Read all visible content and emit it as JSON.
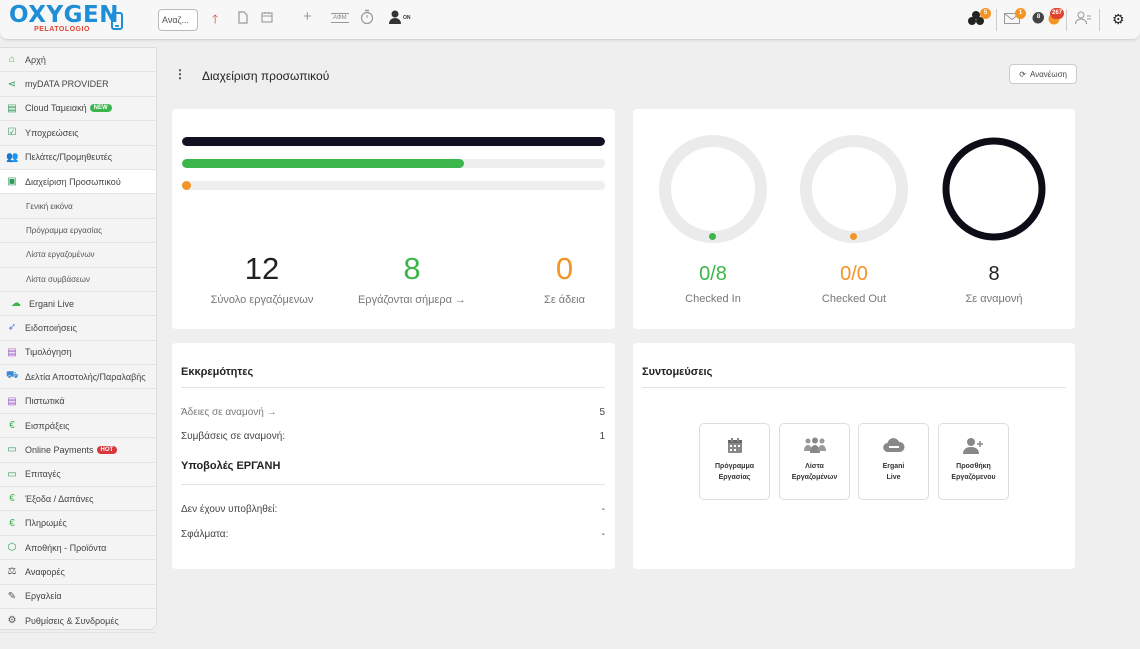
{
  "topbar": {
    "logo": "OXYGEN",
    "logo_sub": "PELATOLOGIO",
    "search_value": "Αναζ...",
    "afm_label": "ΑΦΜ",
    "on_label": "ON",
    "badges": {
      "hub": "5",
      "mail": "1",
      "alerts_dark": "8",
      "alerts_red": "267"
    }
  },
  "sidebar": {
    "items": [
      {
        "label": "Αρχή",
        "icon": "home-icon"
      },
      {
        "label": "myDATA PROVIDER",
        "icon": "share-icon"
      },
      {
        "label": "Cloud Ταμειακή",
        "icon": "register-icon",
        "badge": "NEW"
      },
      {
        "label": "Υποχρεώσεις",
        "icon": "calendar-check-icon"
      },
      {
        "label": "Πελάτες/Προμηθευτές",
        "icon": "users-icon"
      },
      {
        "label": "Διαχείριση Προσωπικού",
        "icon": "staff-icon"
      },
      {
        "label": "Γενική εικόνα"
      },
      {
        "label": "Πρόγραμμα εργασίας"
      },
      {
        "label": "Λίστα εργαζομένων"
      },
      {
        "label": "Λίστα συμβάσεων"
      },
      {
        "label": "Ergani Live",
        "icon": "cloud-icon"
      },
      {
        "label": "Ειδοποιήσεις",
        "icon": "send-icon"
      },
      {
        "label": "Τιμολόγηση",
        "icon": "invoice-icon"
      },
      {
        "label": "Δελτία Αποστολής/Παραλαβής",
        "icon": "truck-icon"
      },
      {
        "label": "Πιστωτικά",
        "icon": "credit-icon"
      },
      {
        "label": "Εισπράξεις",
        "icon": "euro-icon"
      },
      {
        "label": "Online Payments",
        "icon": "payment-icon",
        "badge": "HOT"
      },
      {
        "label": "Επιταγές",
        "icon": "cheque-icon"
      },
      {
        "label": "Έξοδα / Δαπάνες",
        "icon": "euro-icon"
      },
      {
        "label": "Πληρωμές",
        "icon": "euro-icon"
      },
      {
        "label": "Αποθήκη - Προϊόντα",
        "icon": "box-icon"
      },
      {
        "label": "Αναφορές",
        "icon": "scale-icon"
      },
      {
        "label": "Εργαλεία",
        "icon": "pencil-icon"
      },
      {
        "label": "Ρυθμίσεις & Συνδρομές",
        "icon": "gear-icon"
      }
    ]
  },
  "header": {
    "title": "Διαχείριση προσωπικού",
    "refresh_label": "Ανανέωση"
  },
  "summary": {
    "progress": {
      "total": 1.0,
      "working": 0.667,
      "leave": 0.0
    },
    "total_value": "12",
    "total_label": "Σύνολο εργαζόμενων",
    "working_value": "8",
    "working_label": "Εργάζονται σήμερα →",
    "leave_value": "0",
    "leave_label": "Σε άδεια"
  },
  "checkins": {
    "in_value": "0/8",
    "in_label": "Checked In",
    "out_value": "0/0",
    "out_label": "Checked Out",
    "pending_value": "8",
    "pending_label": "Σε αναμονή"
  },
  "pending": {
    "title": "Εκκρεμότητες",
    "rows": [
      {
        "label": "Άδειες σε αναμονή →",
        "value": "5"
      },
      {
        "label": "Συμβάσεις σε αναμονή:",
        "value": "1"
      }
    ],
    "ergani_title": "Υποβολές ΕΡΓΑΝΗ",
    "ergani_rows": [
      {
        "label": "Δεν έχουν υποβληθεί:",
        "value": "-"
      },
      {
        "label": "Σφάλματα:",
        "value": "-"
      }
    ]
  },
  "shortcuts": {
    "title": "Συντομεύσεις",
    "items": [
      {
        "line1": "Πρόγραμμα",
        "line2": "Εργασίας",
        "icon": "calendar-icon"
      },
      {
        "line1": "Λίστα",
        "line2": "Εργαζομένων",
        "icon": "group-icon"
      },
      {
        "line1": "Ergani",
        "line2": "Live",
        "icon": "cloud-icon"
      },
      {
        "line1": "Προσθήκη",
        "line2": "Εργαζόμενου",
        "icon": "add-user-icon"
      }
    ]
  },
  "colors": {
    "brand_blue": "#1e8fd6",
    "green": "#3cb54a",
    "orange": "#f29426",
    "dark": "#111122"
  }
}
